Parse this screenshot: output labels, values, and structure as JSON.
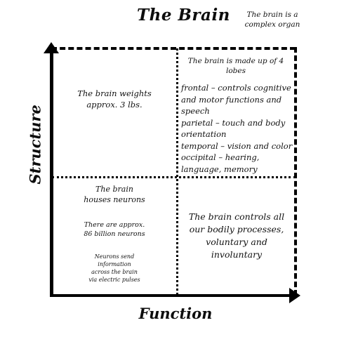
{
  "header": {
    "title": "The Brain",
    "subtitle": "The brain is a\ncomplex organ"
  },
  "axes": {
    "y_label": "Structure",
    "x_label": "Function",
    "y_arrow_icon": "arrow-up-icon",
    "x_arrow_icon": "arrow-right-icon"
  },
  "quadrants": {
    "top_left": {
      "text": "The brain weights\napprox. 3 lbs."
    },
    "top_right": {
      "heading": "The brain is made up of 4\nlobes",
      "items": [
        "frontal – controls cognitive and motor functions and speech",
        "parietal – touch and body orientation",
        "temporal  – vision and color",
        "occipital – hearing, language, memory"
      ]
    },
    "bottom_left": {
      "block_1": "The brain\nhouses neurons",
      "block_2": "There are approx.\n86 billion neurons",
      "block_3": "Neurons send\ninformation\nacross the brain\nvia electric pulses"
    },
    "bottom_right": {
      "text": "The brain controls all\nour bodily processes,\nvoluntary and\ninvoluntary"
    }
  },
  "colors": {
    "ink": "#111111",
    "background": "#ffffff"
  }
}
